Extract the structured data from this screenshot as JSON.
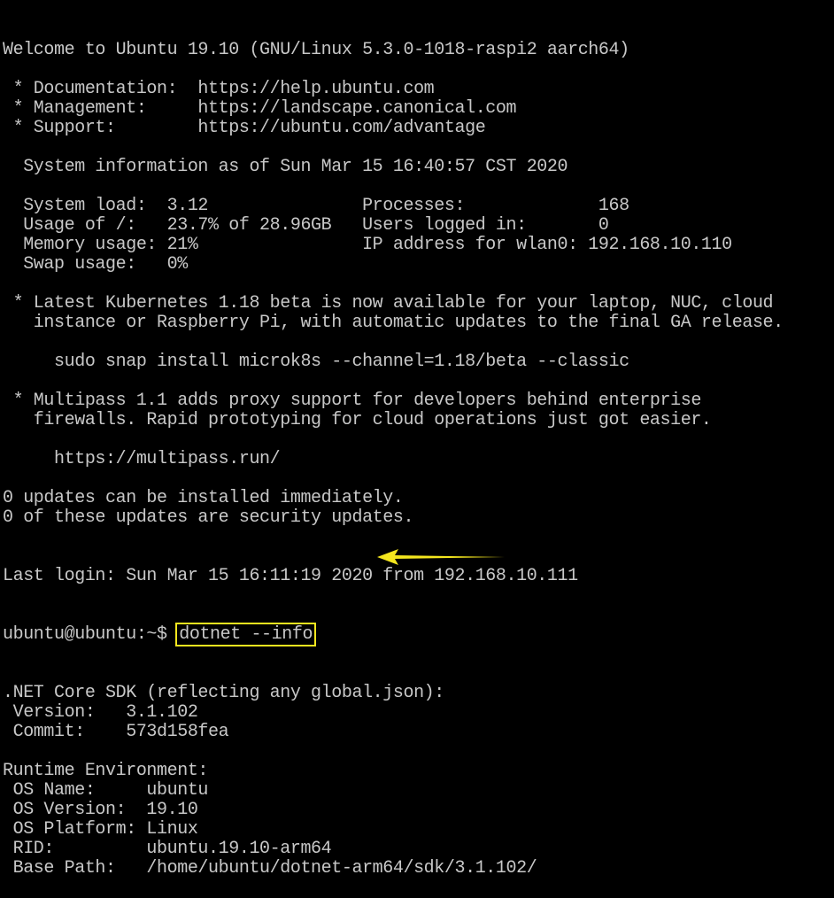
{
  "terminal": {
    "lines": [
      "Welcome to Ubuntu 19.10 (GNU/Linux 5.3.0-1018-raspi2 aarch64)",
      "",
      " * Documentation:  https://help.ubuntu.com",
      " * Management:     https://landscape.canonical.com",
      " * Support:        https://ubuntu.com/advantage",
      "",
      "  System information as of Sun Mar 15 16:40:57 CST 2020",
      "",
      "  System load:  3.12               Processes:             168",
      "  Usage of /:   23.7% of 28.96GB   Users logged in:       0",
      "  Memory usage: 21%                IP address for wlan0: 192.168.10.110",
      "  Swap usage:   0%",
      "",
      " * Latest Kubernetes 1.18 beta is now available for your laptop, NUC, cloud",
      "   instance or Raspberry Pi, with automatic updates to the final GA release.",
      "",
      "     sudo snap install microk8s --channel=1.18/beta --classic",
      "",
      " * Multipass 1.1 adds proxy support for developers behind enterprise",
      "   firewalls. Rapid prototyping for cloud operations just got easier.",
      "",
      "     https://multipass.run/",
      "",
      "0 updates can be installed immediately.",
      "0 of these updates are security updates.",
      "",
      "",
      "Last login: Sun Mar 15 16:11:19 2020 from 192.168.10.111"
    ],
    "prompt": "ubuntu@ubuntu:~$ ",
    "command": "dotnet --info",
    "output": [
      ".NET Core SDK (reflecting any global.json):",
      " Version:   3.1.102",
      " Commit:    573d158fea",
      "",
      "Runtime Environment:",
      " OS Name:     ubuntu",
      " OS Version:  19.10",
      " OS Platform: Linux",
      " RID:         ubuntu.19.10-arm64",
      " Base Path:   /home/ubuntu/dotnet-arm64/sdk/3.1.102/"
    ]
  },
  "colors": {
    "background": "#000000",
    "text": "#c8c8c8",
    "highlight": "#f4e61e"
  },
  "annotation": {
    "icon": "arrow-left-icon"
  }
}
